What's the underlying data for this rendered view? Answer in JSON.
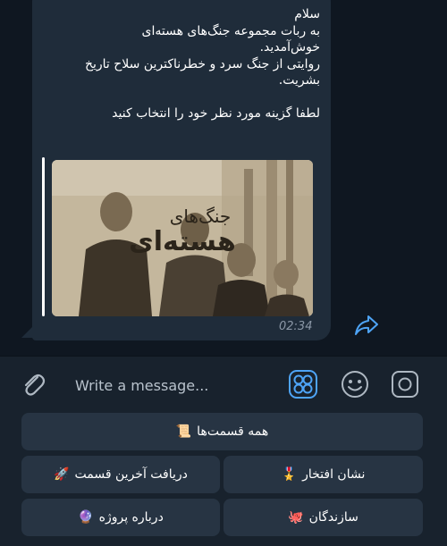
{
  "message": {
    "text": "سلام\nبه ربات مجموعه جنگ‌های هسته‌ای\nخوش‌آمدید.\nروایتی از جنگ سرد و خطرناکترین سلاح تاریخ\nبشریت.\n\nلطفا گزینه مورد نظر خود را انتخاب کنید",
    "preview_title_small": "جنگ‌های",
    "preview_title_large": "هسته‌ای",
    "time": "02:34"
  },
  "composer": {
    "placeholder": "Write a message..."
  },
  "keyboard": {
    "row1": {
      "label": "همه قسمت‌ها",
      "icon": "📜"
    },
    "row2": [
      {
        "label": "دریافت آخرین قسمت",
        "icon": "🚀"
      },
      {
        "label": "نشان افتخار",
        "icon": "🎖️"
      }
    ],
    "row3": [
      {
        "label": "درباره پروژه",
        "icon": "🔮"
      },
      {
        "label": "سازندگان",
        "icon": "🐙"
      }
    ]
  },
  "icons": {
    "forward": "forward-arrow-icon",
    "attach": "paperclip-icon",
    "bot_keyboard": "bot-keyboard-icon",
    "emoji": "smiley-icon",
    "camera": "instagram-camera-icon"
  },
  "colors": {
    "accent": "#4ea4f6",
    "bubble": "#1f2c3a",
    "button": "#273443",
    "background": "#18222d"
  }
}
